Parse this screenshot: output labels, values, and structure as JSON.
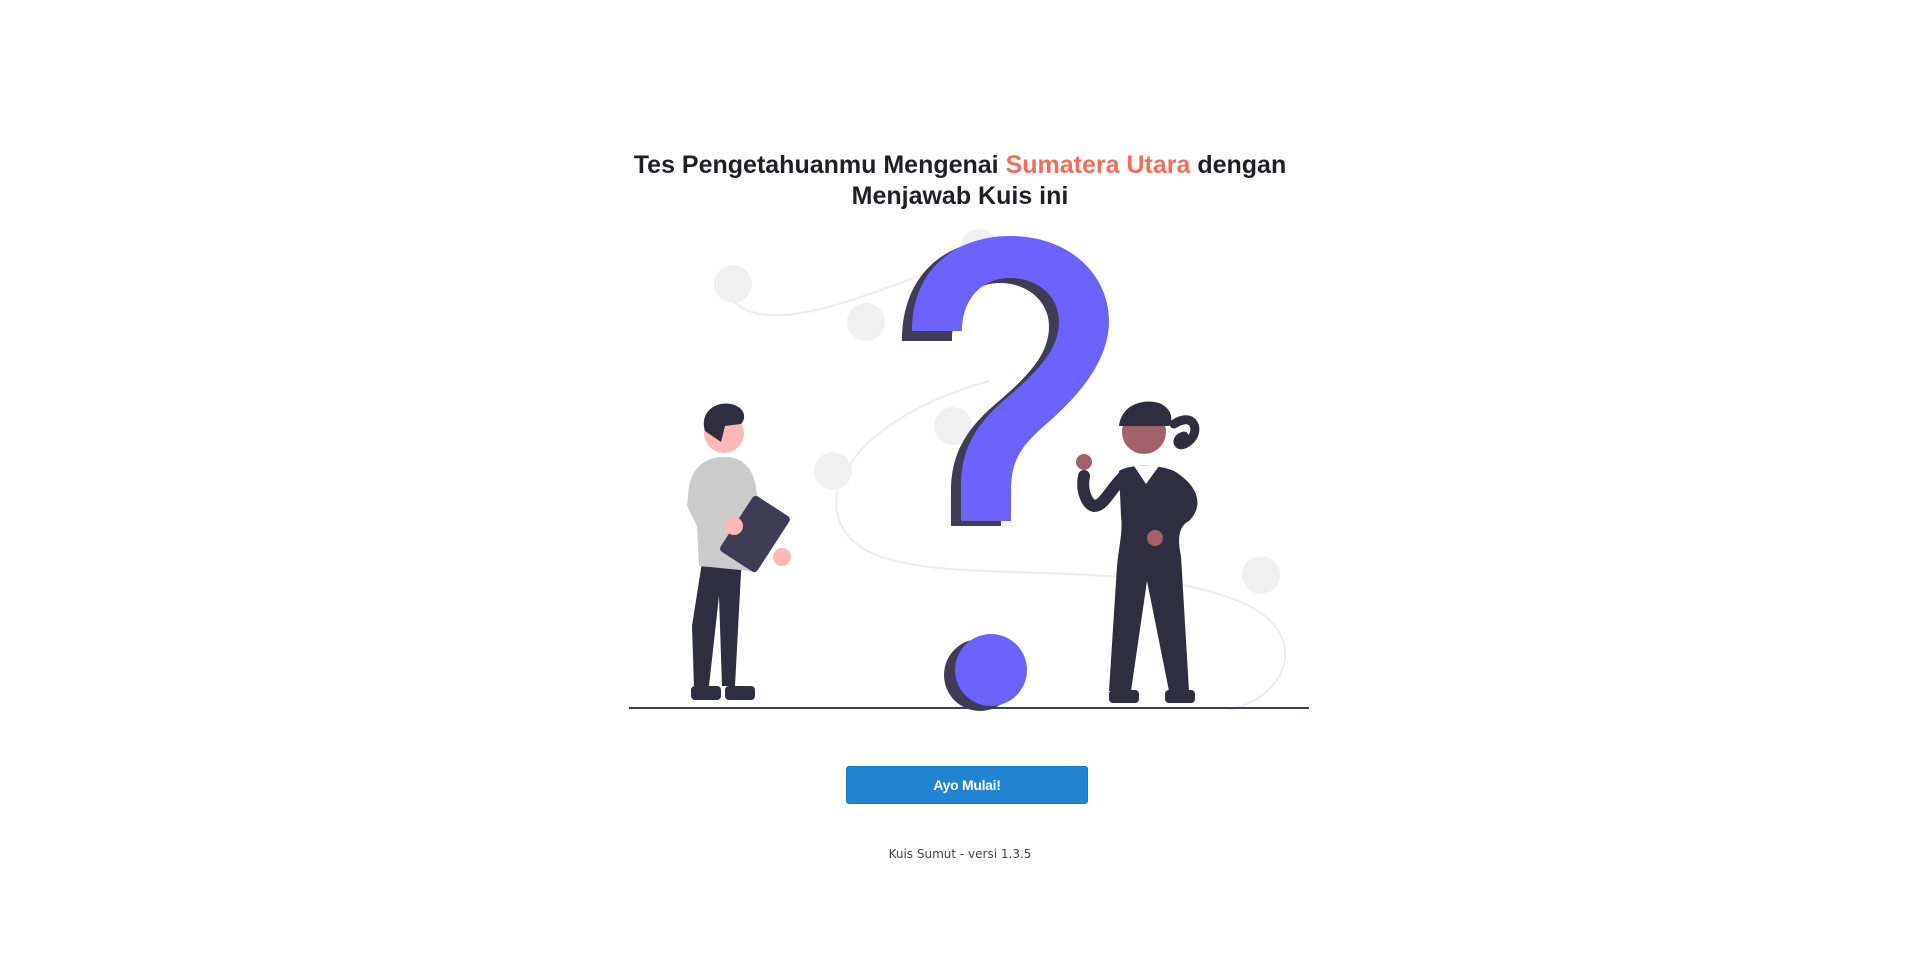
{
  "headline": {
    "part1": "Tes Pengetahuanmu Mengenai ",
    "highlight": "Sumatera Utara",
    "part2": " dengan",
    "line2": "Menjawab Kuis ini"
  },
  "start_button": {
    "label": "Ayo Mulai!"
  },
  "footer": {
    "text": "Kuis Sumut - versi 1.3.5"
  },
  "colors": {
    "accent": "#f16e5c",
    "button": "#2283d2",
    "question_mark": "#6c63ff",
    "dark": "#2f2e41"
  }
}
